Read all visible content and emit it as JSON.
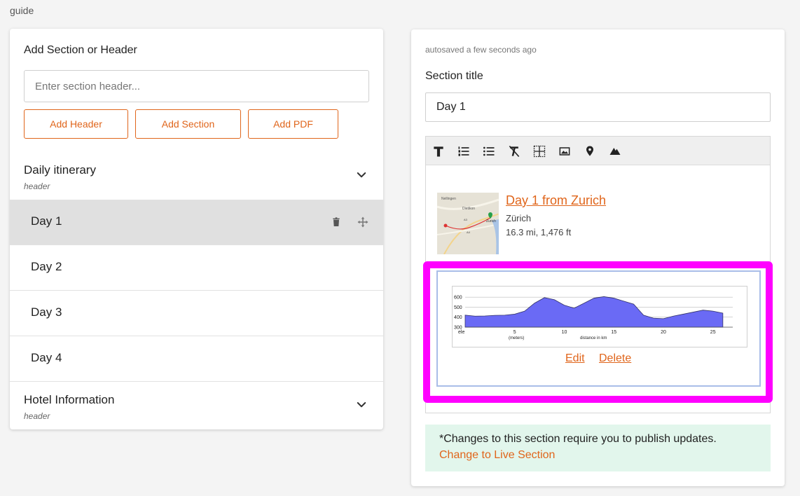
{
  "breadcrumb": "guide",
  "left_panel": {
    "title": "Add Section or Header",
    "input_placeholder": "Enter section header...",
    "buttons": [
      "Add Header",
      "Add Section",
      "Add PDF"
    ],
    "groups": [
      {
        "name": "Daily itinerary",
        "sub": "header",
        "sections": [
          "Day 1",
          "Day 2",
          "Day 3",
          "Day 4"
        ],
        "active_section": "Day 1"
      },
      {
        "name": "Hotel Information",
        "sub": "header",
        "sections": []
      }
    ]
  },
  "right_panel": {
    "autosave": "autosaved a few seconds ago",
    "section_title_label": "Section title",
    "section_title_value": "Day 1",
    "toolbar": [
      "text-format-icon",
      "ordered-list-icon",
      "bullet-list-icon",
      "clear-format-icon",
      "table-icon",
      "image-icon",
      "map-pin-icon",
      "elevation-icon"
    ],
    "route": {
      "title": "Day 1 from Zurich",
      "place": "Zürich",
      "stats": "16.3 mi, 1,476 ft",
      "map_labels": [
        "Nellingen",
        "Dietikon",
        "Zurich",
        "A3",
        "A4"
      ]
    },
    "embed": {
      "edit_label": "Edit",
      "delete_label": "Delete"
    },
    "notice": {
      "text": "*Changes to this section require you to publish updates.",
      "link": "Change to Live Section"
    }
  },
  "chart_data": {
    "type": "area",
    "title": "",
    "xlabel": "distance in km",
    "ylabel": "ele",
    "yunit_label": "(meters)",
    "xlim": [
      0,
      27
    ],
    "ylim": [
      300,
      650
    ],
    "x_ticks": [
      5,
      10,
      15,
      20,
      25
    ],
    "y_ticks": [
      300,
      400,
      500,
      600
    ],
    "x": [
      0,
      1,
      2,
      3,
      4,
      5,
      6,
      7,
      8,
      9,
      10,
      11,
      12,
      13,
      14,
      15,
      16,
      17,
      18,
      19,
      20,
      21,
      22,
      23,
      24,
      25,
      26
    ],
    "values": [
      420,
      410,
      412,
      418,
      420,
      430,
      460,
      540,
      595,
      575,
      520,
      490,
      540,
      590,
      605,
      590,
      560,
      530,
      420,
      390,
      385,
      410,
      430,
      450,
      470,
      460,
      440
    ],
    "fill_color": "#6a6af5",
    "line_color": "#333366"
  }
}
